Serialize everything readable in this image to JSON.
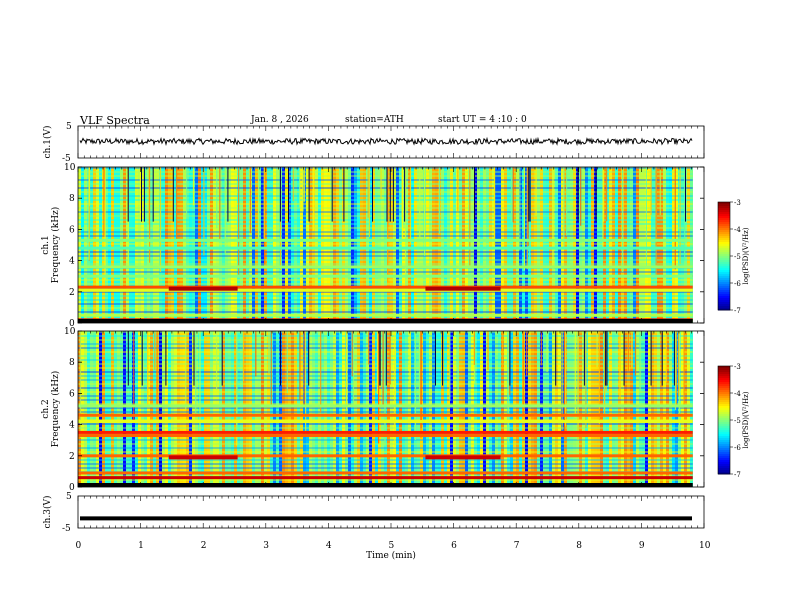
{
  "header": {
    "title": "VLF  Spectra",
    "date": "Jan. 8 , 2026",
    "station": "station=ATH",
    "start": "start  UT  =   4  :10 : 0"
  },
  "chart_data": [
    {
      "type": "line",
      "ylabel": "ch.1(V)",
      "ylim": [
        -5,
        5
      ],
      "yticks": [
        "5",
        "-5"
      ],
      "xlim": [
        0,
        10
      ],
      "series": [
        {
          "level": 0.2,
          "noise_amplitude": 0.9
        }
      ]
    },
    {
      "type": "heatmap",
      "panel_label": "ch.1",
      "ylabel": "Frequency (kHz)",
      "ylim": [
        0,
        10
      ],
      "yticks": [
        "0",
        "2",
        "4",
        "6",
        "8",
        "10"
      ],
      "xlim": [
        0,
        10
      ],
      "data_end_min": 9.82,
      "colorbar": {
        "label": "log(PSD)(V²/Hz)",
        "ticks": [
          "-3",
          "-4",
          "-5",
          "-6",
          "-7"
        ],
        "range": [
          -7,
          -3
        ]
      },
      "bands": [
        {
          "freq_khz": 0.2,
          "level": -3.4
        },
        {
          "freq_khz": 0.5,
          "level": -4.8
        },
        {
          "freq_khz": 2.1,
          "level": -4.6
        },
        {
          "freq_khz": 2.3,
          "level": -3.8
        },
        {
          "freq_khz": 3.0,
          "level": -5.0
        },
        {
          "freq_khz": 3.6,
          "level": -4.9
        },
        {
          "freq_khz": 4.8,
          "level": -5.2
        },
        {
          "freq_khz": 5.3,
          "level": -5.0
        }
      ],
      "bursts": [
        {
          "t0_min": 1.45,
          "t1_min": 2.55,
          "freq_khz": 2.2,
          "level": -3.2
        },
        {
          "t0_min": 5.55,
          "t1_min": 6.75,
          "freq_khz": 2.2,
          "level": -3.2
        }
      ]
    },
    {
      "type": "heatmap",
      "panel_label": "ch.2",
      "ylabel": "Frequency (kHz)",
      "ylim": [
        0,
        10
      ],
      "yticks": [
        "0",
        "2",
        "4",
        "6",
        "8",
        "10"
      ],
      "xlim": [
        0,
        10
      ],
      "data_end_min": 9.82,
      "colorbar": {
        "label": "log(PSD)(V²/Hz)",
        "ticks": [
          "-3",
          "-4",
          "-5",
          "-6",
          "-7"
        ],
        "range": [
          -7,
          -3
        ]
      },
      "bands": [
        {
          "freq_khz": 0.6,
          "level": -3.3
        },
        {
          "freq_khz": 0.9,
          "level": -3.9
        },
        {
          "freq_khz": 2.0,
          "level": -3.9
        },
        {
          "freq_khz": 3.3,
          "level": -3.9
        },
        {
          "freq_khz": 3.5,
          "level": -3.6
        },
        {
          "freq_khz": 4.2,
          "level": -4.6
        },
        {
          "freq_khz": 4.6,
          "level": -3.9
        },
        {
          "freq_khz": 5.2,
          "level": -4.9
        }
      ],
      "bursts": [
        {
          "t0_min": 1.45,
          "t1_min": 2.55,
          "freq_khz": 1.9,
          "level": -3.3
        },
        {
          "t0_min": 5.55,
          "t1_min": 6.75,
          "freq_khz": 1.9,
          "level": -3.3
        }
      ]
    },
    {
      "type": "line",
      "ylabel": "ch.3(V)",
      "ylim": [
        -5,
        5
      ],
      "yticks": [
        "5",
        "-5"
      ],
      "xlim": [
        0,
        10
      ],
      "series": [
        {
          "level": -2.0,
          "noise_amplitude": 0.0
        }
      ]
    }
  ],
  "xaxis": {
    "label": "Time  (min)",
    "ticks": [
      "0",
      "1",
      "2",
      "3",
      "4",
      "5",
      "6",
      "7",
      "8",
      "9",
      "10"
    ]
  }
}
